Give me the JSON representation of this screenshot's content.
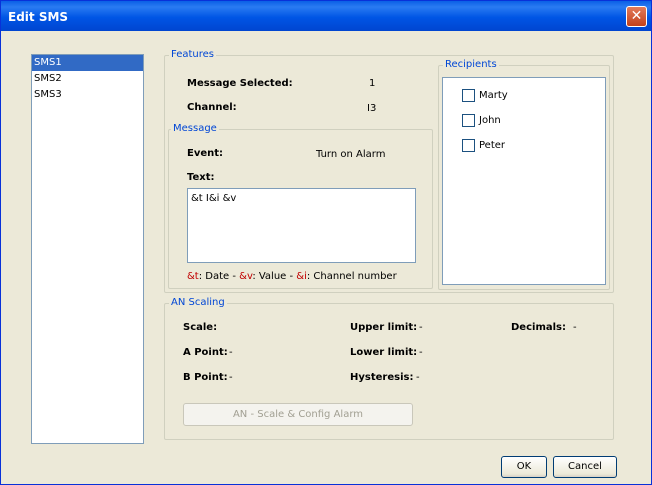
{
  "window": {
    "title": "Edit SMS",
    "close_glyph": "✕"
  },
  "sms_list": {
    "items": [
      "SMS1",
      "SMS2",
      "SMS3"
    ],
    "selected": 0
  },
  "features": {
    "legend": "Features",
    "message_selected_label": "Message Selected:",
    "message_selected_value": "1",
    "channel_label": "Channel:",
    "channel_value": "I3"
  },
  "message": {
    "legend": "Message",
    "event_label": "Event:",
    "event_value": "Turn on Alarm",
    "text_label": "Text:",
    "text_value": "&t I&i &v",
    "legend_items": [
      {
        "code": "&t",
        "desc": ": Date - "
      },
      {
        "code": "&v",
        "desc": ": Value - "
      },
      {
        "code": "&i",
        "desc": ": Channel number"
      }
    ]
  },
  "recipients": {
    "legend": "Recipients",
    "items": [
      {
        "name": "Marty",
        "checked": false
      },
      {
        "name": "John",
        "checked": false
      },
      {
        "name": "Peter",
        "checked": false
      }
    ]
  },
  "an_scaling": {
    "legend": "AN Scaling",
    "scale_label": "Scale:",
    "a_point_label": "A Point:",
    "a_point_value": "-",
    "b_point_label": "B Point:",
    "b_point_value": "-",
    "upper_limit_label": "Upper limit:",
    "upper_limit_value": "-",
    "lower_limit_label": "Lower limit:",
    "lower_limit_value": "-",
    "hysteresis_label": "Hysteresis:",
    "hysteresis_value": "-",
    "decimals_label": "Decimals:",
    "decimals_value": "-",
    "config_button": "AN - Scale & Config Alarm"
  },
  "buttons": {
    "ok": "OK",
    "cancel": "Cancel"
  },
  "colors": {
    "accent": "#0046d5",
    "selection": "#316ac5",
    "legend_code": "#c00000"
  }
}
